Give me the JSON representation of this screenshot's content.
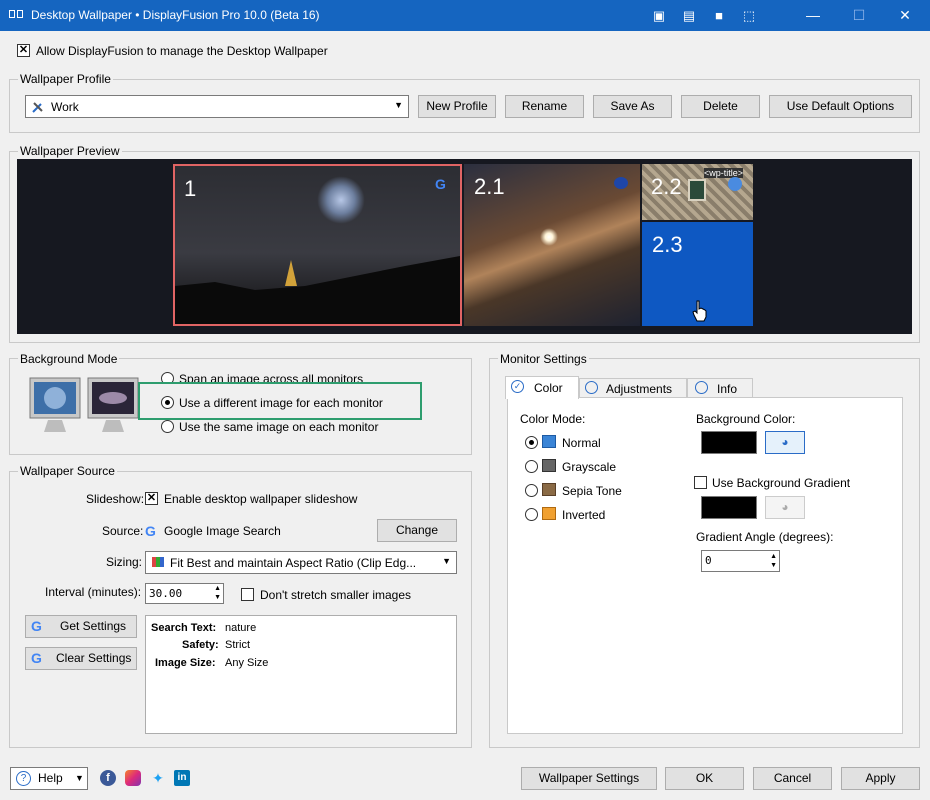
{
  "window": {
    "title": "Desktop Wallpaper • DisplayFusion Pro 10.0 (Beta 16)"
  },
  "allow_manage": {
    "label": "Allow DisplayFusion to manage the Desktop Wallpaper",
    "checked": true
  },
  "profile": {
    "group_label": "Wallpaper Profile",
    "selected": "Work",
    "buttons": {
      "new": "New Profile",
      "rename": "Rename",
      "save_as": "Save As",
      "delete": "Delete",
      "defaults": "Use Default Options"
    }
  },
  "preview": {
    "group_label": "Wallpaper Preview",
    "monitors": {
      "m1": "1",
      "m21": "2.1",
      "m22": "2.2",
      "m23": "2.3"
    },
    "wp_title_tag": "<wp-title>"
  },
  "background_mode": {
    "group_label": "Background Mode",
    "options": [
      {
        "label": "Span an image across all monitors",
        "selected": false
      },
      {
        "label": "Use a different image for each monitor",
        "selected": true
      },
      {
        "label": "Use the same image on each monitor",
        "selected": false
      }
    ],
    "highlight_color": "#2e9d6e"
  },
  "source": {
    "group_label": "Wallpaper Source",
    "slideshow_label": "Slideshow:",
    "slideshow_check": "Enable desktop wallpaper slideshow",
    "source_label": "Source:",
    "source_value": "Google Image Search",
    "change_button": "Change",
    "sizing_label": "Sizing:",
    "sizing_value": "Fit Best and maintain Aspect Ratio (Clip Edg...",
    "interval_label": "Interval (minutes):",
    "interval_value": "30.00",
    "no_stretch_label": "Don't stretch smaller images",
    "get_settings": "Get Settings",
    "clear_settings": "Clear Settings",
    "settings_info": [
      {
        "key": "Search Text:",
        "value": "nature"
      },
      {
        "key": "Safety:",
        "value": "Strict"
      },
      {
        "key": "Image Size:",
        "value": "Any Size"
      }
    ]
  },
  "monitor_settings": {
    "group_label": "Monitor Settings",
    "tabs": {
      "color": "Color",
      "adjustments": "Adjustments",
      "info": "Info"
    },
    "color_mode_label": "Color Mode:",
    "color_modes": [
      {
        "label": "Normal",
        "selected": true
      },
      {
        "label": "Grayscale",
        "selected": false
      },
      {
        "label": "Sepia Tone",
        "selected": false
      },
      {
        "label": "Inverted",
        "selected": false
      }
    ],
    "bg_color_label": "Background Color:",
    "bg_color": "#000000",
    "use_gradient_label": "Use Background Gradient",
    "gradient_angle_label": "Gradient Angle (degrees):",
    "gradient_angle_value": "0"
  },
  "footer": {
    "help": "Help",
    "wallpaper_settings": "Wallpaper Settings",
    "ok": "OK",
    "cancel": "Cancel",
    "apply": "Apply"
  },
  "colors": {
    "titlebar": "#1565c0",
    "monitor_selected": "#0e58c2",
    "monitor_border_active": "#e06464"
  }
}
